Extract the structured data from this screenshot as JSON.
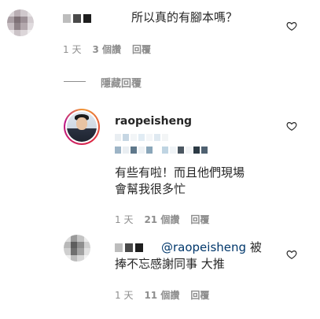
{
  "comment1": {
    "text": "所以真的有腳本嗎？",
    "meta": {
      "time": "1 天",
      "likes": "3 個讚",
      "reply": "回覆"
    }
  },
  "hide_replies": {
    "label": "隱藏回覆"
  },
  "reply1": {
    "username": "raopeisheng",
    "lines": [
      "有些有啦！而且他們現場",
      "會幫我很多忙"
    ],
    "meta": {
      "time": "1 天",
      "likes": "21 個讚",
      "reply": "回覆"
    }
  },
  "reply2": {
    "mention": "@raopeisheng",
    "text_after_mention": "被",
    "line2": "捧不忘感謝同事 大推",
    "meta": {
      "time": "1 天",
      "likes": "11 個讚",
      "reply": "回覆"
    }
  },
  "icons": {
    "like": "heart-icon"
  },
  "colors": {
    "text": "#262626",
    "secondary": "#8e8e8e",
    "mention": "#00376b"
  }
}
